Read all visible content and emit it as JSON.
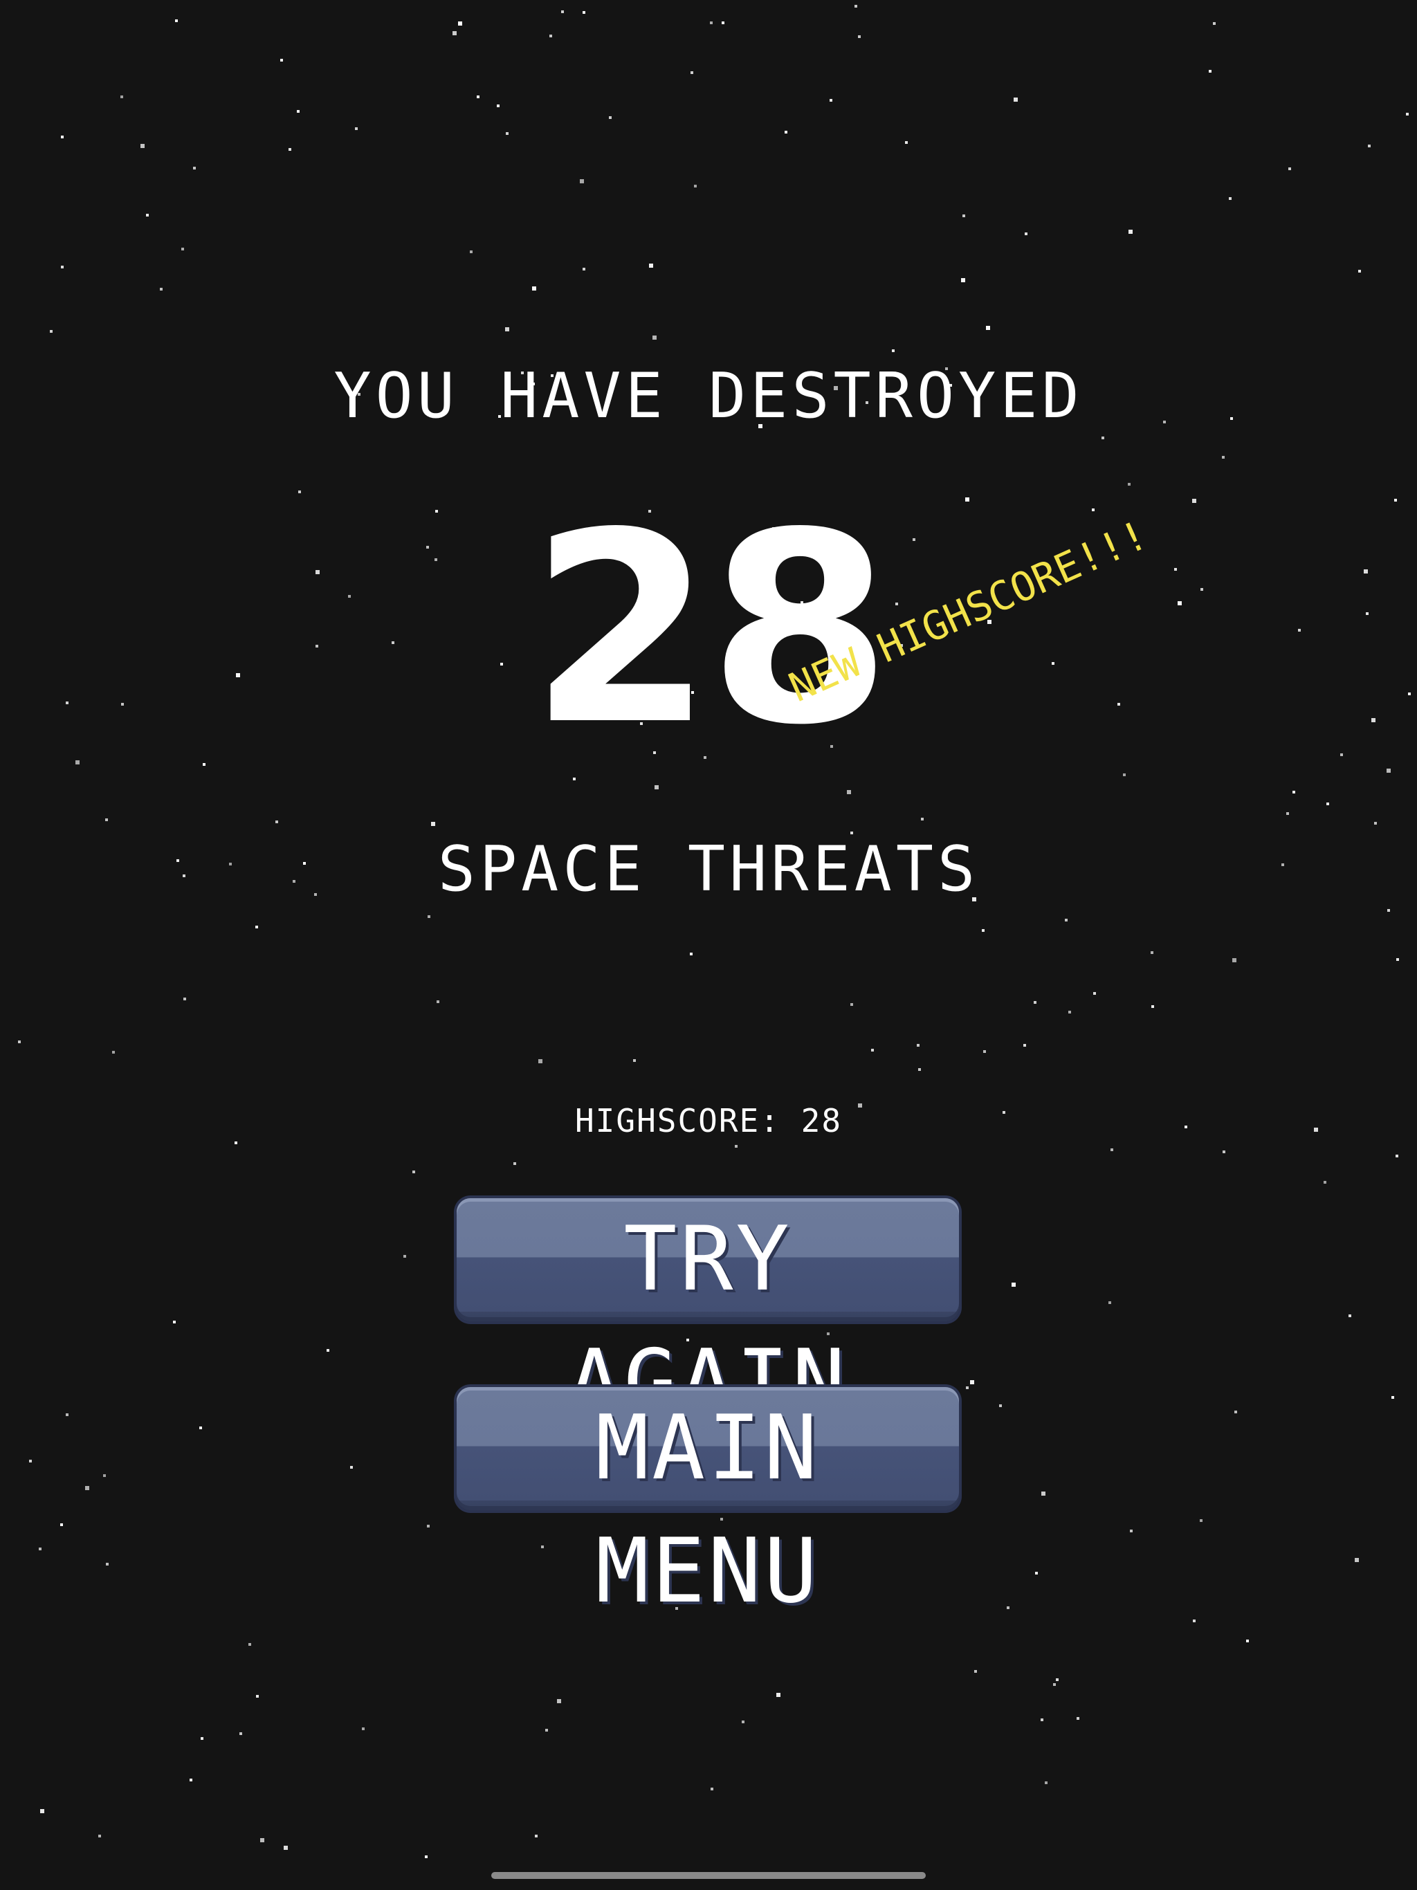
{
  "game_over": {
    "line_top": "YOU HAVE DESTROYED",
    "score": "28",
    "line_bottom": "SPACE THREATS",
    "new_highscore_badge": "NEW HIGHSCORE!!!",
    "highscore_text": "HIGHSCORE: 28"
  },
  "buttons": {
    "try_again_label": "TRY AGAIN",
    "main_menu_label": "MAIN MENU"
  },
  "colors": {
    "background": "#141414",
    "text": "#ffffff",
    "badge": "#f2e24a",
    "button_top": "#6c7a9b",
    "button_bottom": "#465378"
  }
}
